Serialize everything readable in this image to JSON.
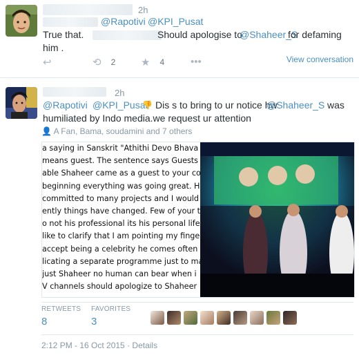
{
  "tweet1": {
    "time": "2h",
    "mentions": [
      "@Rapotivi",
      "@KPI_Pusat"
    ],
    "text_start": "True that.",
    "text_middle": "Should apologise to",
    "mention_target": "@Shaheer_S",
    "text_end": "for defaming him .",
    "retweet_count": "2",
    "favorite_count": "4",
    "view_conversation": "View conversation"
  },
  "tweet2": {
    "time": "2h",
    "mentions": [
      "@Rapotivi",
      "@KPI_Pusat"
    ],
    "emoji": "👎",
    "text_part1": "Dis s to bring to ur notice hw",
    "mention_target": "@Shaheer_S",
    "text_part2": "was humiliated by Indo media.we request ur attention",
    "context_line": "A Fan, Bama, soudamini and 7 others",
    "image_text_lines": [
      "a saying in Sanskrit \"Athithi Devo Bhava",
      "means guest. The sentence says Guests",
      "able Shaheer came as a guest to your cou",
      "beginning everything was going great. He",
      "committed to many projects and I would",
      "ently things have changed. Few of your t",
      "o not his professional its his personal life",
      " like to clarify that I am pointing my finge",
      " accept being a celebrity he comes often",
      "licating a separate programme just to ma",
      " just Shaheer no human can bear when i",
      "V channels should apologize to Shaheer"
    ],
    "retweets_label": "RETWEETS",
    "retweets_value": "8",
    "favorites_label": "FAVORITES",
    "favorites_value": "3",
    "timestamp": "2:12 PM - 16 Oct 2015",
    "details": "Details"
  },
  "colors": {
    "link": "#4a90c2",
    "meta": "#8899a6",
    "text": "#292f33",
    "border": "#e1e8ed"
  }
}
